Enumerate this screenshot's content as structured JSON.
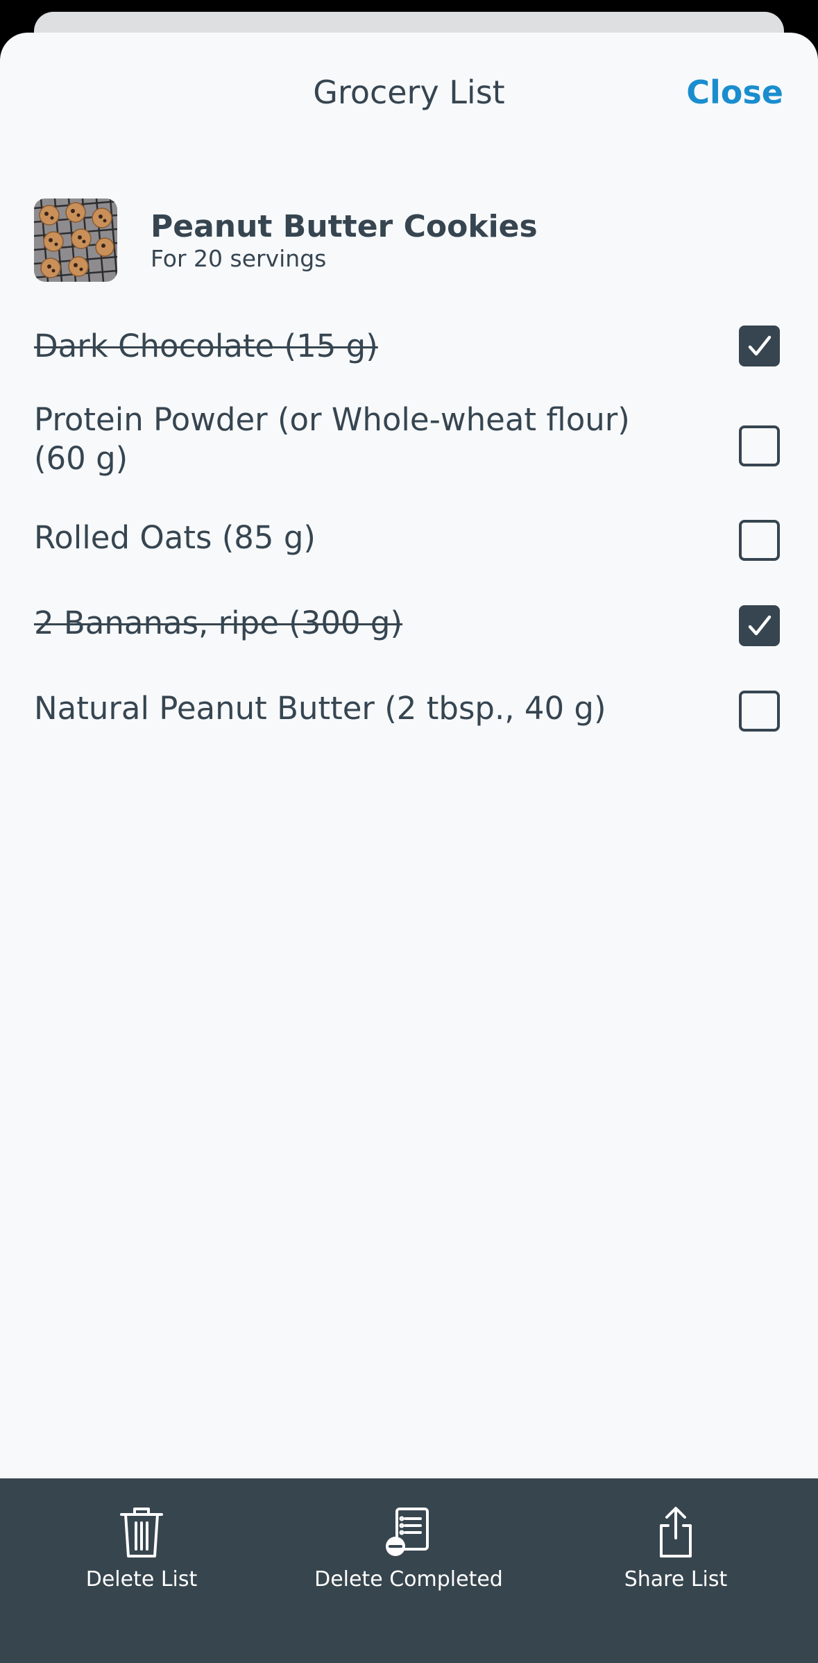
{
  "header": {
    "title": "Grocery List",
    "close_label": "Close"
  },
  "recipe": {
    "name": "Peanut Butter Cookies",
    "servings": "For 20 servings",
    "thumbnail_icon": "cookie-photo"
  },
  "items": [
    {
      "text": "Dark Chocolate (15 g)",
      "checked": true
    },
    {
      "text": "Protein Powder (or Whole-wheat flour) (60 g)",
      "checked": false
    },
    {
      "text": "Rolled Oats (85 g)",
      "checked": false
    },
    {
      "text": "2 Bananas, ripe (300 g)",
      "checked": true
    },
    {
      "text": "Natural Peanut Butter (2 tbsp., 40 g)",
      "checked": false
    }
  ],
  "actions": {
    "delete_list": {
      "label": "Delete List",
      "icon": "trash-icon"
    },
    "delete_completed": {
      "label": "Delete Completed",
      "icon": "delete-completed-icon"
    },
    "share_list": {
      "label": "Share List",
      "icon": "share-icon"
    }
  },
  "colors": {
    "accent": "#1a8dce",
    "text": "#364550",
    "background": "#f7f9fb",
    "bottom_bar": "#37454e"
  }
}
